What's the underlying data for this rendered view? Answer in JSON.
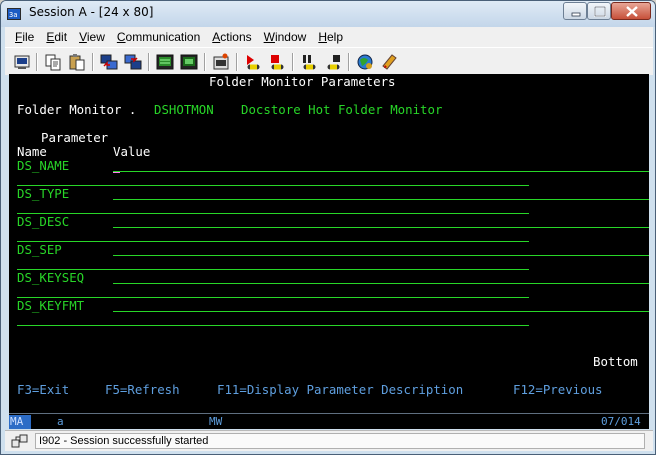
{
  "window": {
    "title": "Session A - [24 x 80]"
  },
  "menu": [
    {
      "key": "F",
      "rest": "ile"
    },
    {
      "key": "E",
      "rest": "dit"
    },
    {
      "key": "V",
      "rest": "iew"
    },
    {
      "key": "C",
      "rest": "ommunication"
    },
    {
      "key": "A",
      "rest": "ctions"
    },
    {
      "key": "W",
      "rest": "indow"
    },
    {
      "key": "H",
      "rest": "elp"
    }
  ],
  "toolbar": [
    "print-screen",
    "copy",
    "paste",
    "send-file",
    "receive-file",
    "display-macro",
    "record-macro",
    "quick-map",
    "play-macro",
    "stop-macro",
    "pause-macro",
    "start-macro",
    "customize",
    "web-link",
    "notes"
  ],
  "screen": {
    "title": "Folder Monitor Parameters",
    "monitor_label": "Folder Monitor . ",
    "monitor_code": "DSHOTMON",
    "monitor_desc": "Docstore Hot Folder Monitor",
    "col_param_top": "Parameter",
    "col_name": "Name",
    "col_value": "Value",
    "params": [
      {
        "name": "DS_NAME",
        "value": ""
      },
      {
        "name": "DS_TYPE",
        "value": ""
      },
      {
        "name": "DS_DESC",
        "value": ""
      },
      {
        "name": "DS_SEP",
        "value": ""
      },
      {
        "name": "DS_KEYSEQ",
        "value": ""
      },
      {
        "name": "DS_KEYFMT",
        "value": ""
      }
    ],
    "bottom_indicator": "Bottom",
    "fkeys": {
      "f3": "F3=Exit",
      "f5": "F5=Refresh",
      "f11": "F11=Display Parameter Description",
      "f12": "F12=Previous"
    }
  },
  "oia": {
    "mode": "MA",
    "flag": "a",
    "mw": "MW",
    "position": "07/014"
  },
  "status": {
    "message": "I902 - Session successfully started"
  },
  "colors": {
    "terminal_bg": "#000000",
    "field_green": "#28d628",
    "text_white": "#ffffff",
    "info_blue": "#5f9fdf"
  }
}
